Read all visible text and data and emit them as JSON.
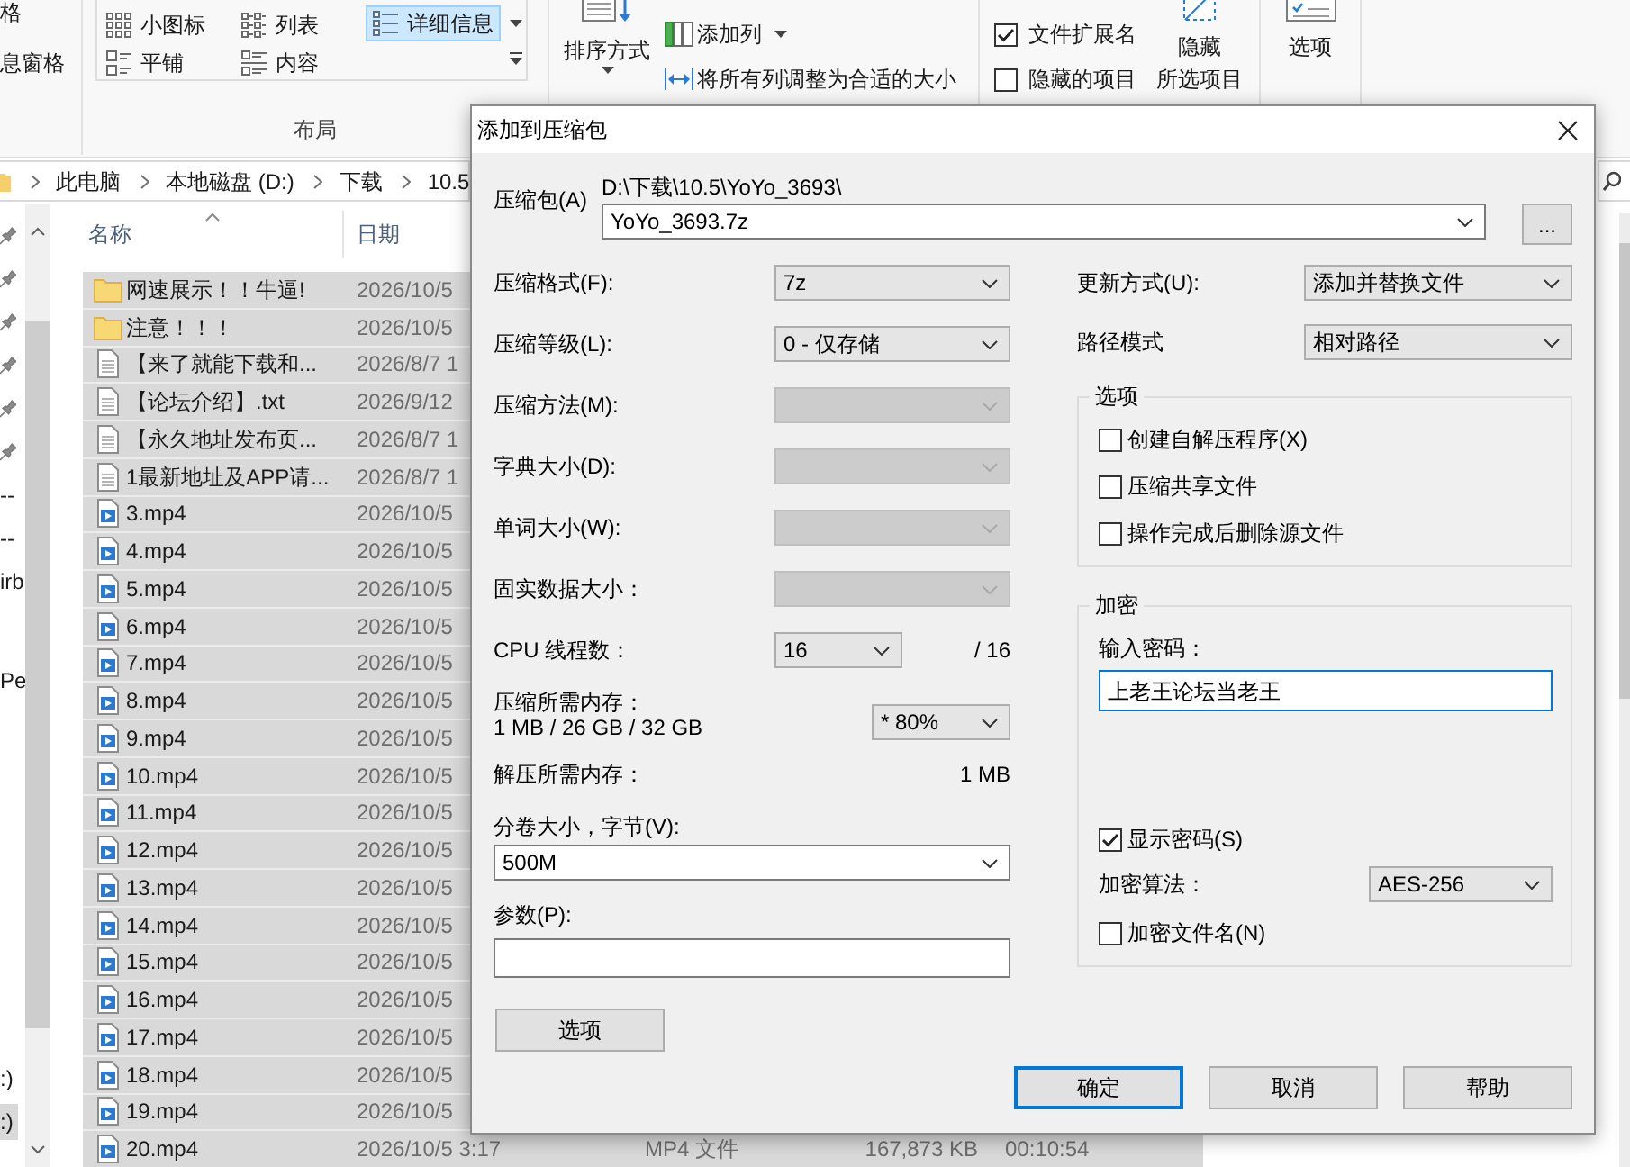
{
  "ribbon": {
    "pane_buttons": [
      "格",
      "息窗格"
    ],
    "layout": {
      "label": "布局",
      "views": [
        {
          "kind": "small",
          "label": "小图标",
          "selected": false
        },
        {
          "kind": "list",
          "label": "列表",
          "selected": false
        },
        {
          "kind": "details",
          "label": "详细信息",
          "selected": true
        },
        {
          "kind": "tiles",
          "label": "平铺",
          "selected": false
        },
        {
          "kind": "content",
          "label": "内容",
          "selected": false
        }
      ]
    },
    "current_view": {
      "sort_by": "排序方式",
      "add_columns": "添加列",
      "size_columns": "将所有列调整为合适的大小"
    },
    "show_hide": {
      "checkboxes": [
        {
          "label": "文件扩展名",
          "checked": true
        },
        {
          "label": "隐藏的项目",
          "checked": false
        }
      ],
      "hide_selected": [
        "隐藏",
        "所选项目"
      ]
    },
    "options": "选项"
  },
  "address_bar": {
    "breadcrumb": [
      "此电脑",
      "本地磁盘 (D:)",
      "下载",
      "10.5"
    ]
  },
  "nav_pane": {
    "sections": [
      {
        "items": [
          {
            "pinned": true,
            "selected": false
          },
          {
            "pinned": true,
            "selected": false
          },
          {
            "pinned": true,
            "selected": false
          },
          {
            "pinned": true,
            "selected": false
          },
          {
            "pinned": true,
            "selected": false
          },
          {
            "pinned": true,
            "selected": false
          },
          {
            "label": "--",
            "pinned": false,
            "selected": false
          },
          {
            "label": "--",
            "pinned": false,
            "selected": false
          },
          {
            "label": "irb",
            "pinned": false,
            "selected": false
          }
        ]
      },
      {
        "items": [
          {
            "label": "Pe",
            "pinned": false,
            "selected": false
          }
        ]
      },
      {
        "items": [
          {
            "label": ":)",
            "pinned": false,
            "selected": false
          },
          {
            "label": ":)",
            "pinned": false,
            "selected": true
          }
        ]
      }
    ]
  },
  "file_list": {
    "columns": [
      {
        "label": "名称",
        "sorted": true
      },
      {
        "label": "日期",
        "sorted": false
      }
    ],
    "rows": [
      {
        "kind": "folder",
        "name": "网速展示！！牛逼!",
        "date": "2026/10/5",
        "selected": true
      },
      {
        "kind": "folder",
        "name": "注意！！！",
        "date": "2026/10/5",
        "selected": true
      },
      {
        "kind": "text",
        "name": "【来了就能下载和...",
        "date": "2026/8/7 1",
        "selected": true
      },
      {
        "kind": "text",
        "name": "【论坛介绍】.txt",
        "date": "2026/9/12",
        "selected": true
      },
      {
        "kind": "text",
        "name": "【永久地址发布页...",
        "date": "2026/8/7 1",
        "selected": true
      },
      {
        "kind": "text",
        "name": "1最新地址及APP请...",
        "date": "2026/8/7 1",
        "selected": true
      },
      {
        "kind": "video",
        "name": "3.mp4",
        "date": "2026/10/5",
        "selected": true
      },
      {
        "kind": "video",
        "name": "4.mp4",
        "date": "2026/10/5",
        "selected": true
      },
      {
        "kind": "video",
        "name": "5.mp4",
        "date": "2026/10/5",
        "selected": true
      },
      {
        "kind": "video",
        "name": "6.mp4",
        "date": "2026/10/5",
        "selected": true
      },
      {
        "kind": "video",
        "name": "7.mp4",
        "date": "2026/10/5",
        "selected": true
      },
      {
        "kind": "video",
        "name": "8.mp4",
        "date": "2026/10/5",
        "selected": true
      },
      {
        "kind": "video",
        "name": "9.mp4",
        "date": "2026/10/5",
        "selected": true
      },
      {
        "kind": "video",
        "name": "10.mp4",
        "date": "2026/10/5",
        "selected": true
      },
      {
        "kind": "video",
        "name": "11.mp4",
        "date": "2026/10/5",
        "selected": true
      },
      {
        "kind": "video",
        "name": "12.mp4",
        "date": "2026/10/5",
        "selected": true
      },
      {
        "kind": "video",
        "name": "13.mp4",
        "date": "2026/10/5",
        "selected": true
      },
      {
        "kind": "video",
        "name": "14.mp4",
        "date": "2026/10/5",
        "selected": true
      },
      {
        "kind": "video",
        "name": "15.mp4",
        "date": "2026/10/5",
        "selected": true
      },
      {
        "kind": "video",
        "name": "16.mp4",
        "date": "2026/10/5",
        "selected": true
      },
      {
        "kind": "video",
        "name": "17.mp4",
        "date": "2026/10/5",
        "selected": true
      },
      {
        "kind": "video",
        "name": "18.mp4",
        "date": "2026/10/5",
        "selected": true
      },
      {
        "kind": "video",
        "name": "19.mp4",
        "date": "2026/10/5",
        "selected": true
      },
      {
        "kind": "video",
        "name": "20.mp4",
        "date": "2026/10/5 3:17",
        "type": "MP4 文件",
        "size": "167,873 KB",
        "length": "00:10:54",
        "selected": true
      }
    ]
  },
  "dialog": {
    "title": "添加到压缩包",
    "archive": {
      "label": "压缩包(A)",
      "folder": "D:\\下载\\10.5\\YoYo_3693\\",
      "value": "YoYo_3693.7z",
      "browse": "..."
    },
    "settings": [
      {
        "label": "压缩格式(F):",
        "value": "7z",
        "disabled": false
      },
      {
        "label": "压缩等级(L):",
        "value": "0 - 仅存储",
        "disabled": false
      },
      {
        "label": "压缩方法(M):",
        "disabled": true
      },
      {
        "label": "字典大小(D):",
        "disabled": true
      },
      {
        "label": "单词大小(W):",
        "disabled": true
      },
      {
        "label": "固实数据大小：",
        "disabled": true
      }
    ],
    "threads": {
      "label": "CPU 线程数：",
      "value": "16",
      "max": "/ 16"
    },
    "memory": {
      "label": "压缩所需内存：",
      "usage": "1 MB / 26 GB / 32 GB",
      "value": "* 80%"
    },
    "decompression_memory": {
      "label": "解压所需内存：",
      "value": "1 MB"
    },
    "volume": {
      "label": "分卷大小，字节(V):",
      "value": "500M"
    },
    "parameters": {
      "label": "参数(P):"
    },
    "options_button": "选项",
    "update_mode": {
      "label": "更新方式(U):",
      "value": "添加并替换文件"
    },
    "path_mode": {
      "label": "路径模式",
      "value": "相对路径"
    },
    "options_group": {
      "title": "选项",
      "checkboxes": [
        {
          "label": "创建自解压程序(X)",
          "checked": false
        },
        {
          "label": "压缩共享文件",
          "checked": false
        },
        {
          "label": "操作完成后删除源文件",
          "checked": false
        }
      ]
    },
    "encryption": {
      "title": "加密",
      "password_label": "输入密码：",
      "password": {
        "value": "上老王论坛当老王",
        "focused": true
      },
      "show_password": {
        "label": "显示密码(S)",
        "checked": true
      },
      "method_label": "加密算法：",
      "method": "AES-256",
      "encrypt_names": {
        "label": "加密文件名(N)",
        "checked": false
      }
    },
    "buttons": [
      {
        "label": "确定",
        "default": true
      },
      {
        "label": "取消",
        "default": false
      },
      {
        "label": "帮助",
        "default": false
      }
    ]
  }
}
